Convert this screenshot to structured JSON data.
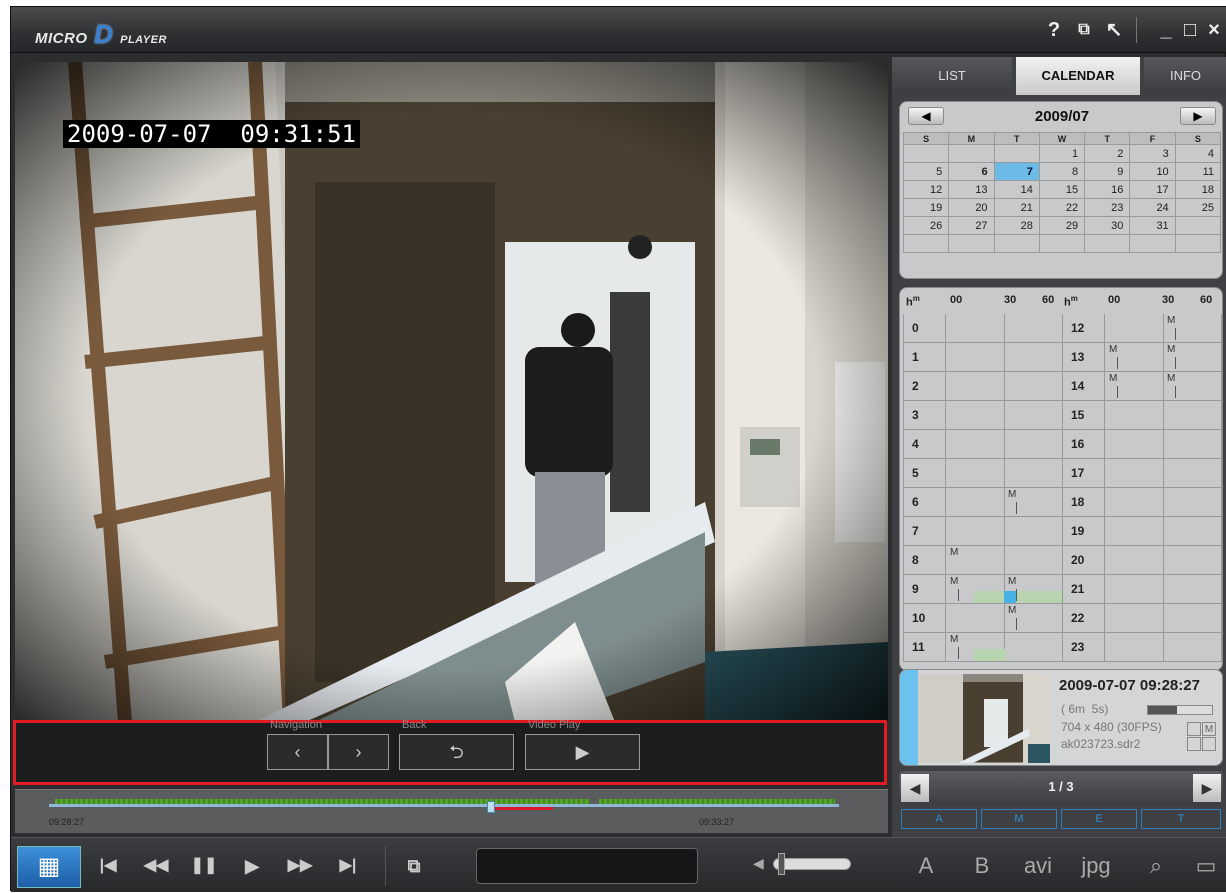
{
  "app": {
    "logo": {
      "micro": "MICRO",
      "d": "D",
      "player": "PLAYER"
    },
    "controls": {
      "help": "?",
      "screen": "⧉",
      "tools": "↖",
      "min": "_",
      "max": "□",
      "close": "×"
    }
  },
  "video": {
    "timestamp": "2009-07-07  09:31:51"
  },
  "nav": {
    "navigation_label": "Navigation",
    "back_label": "Back",
    "videoplay_label": "Video Play",
    "prev_icon": "‹",
    "next_icon": "›",
    "back_icon": "⮌",
    "play_icon": "▶"
  },
  "timeline": {
    "start_time": "09:28:27",
    "end_time": "09:33:27"
  },
  "tabs": {
    "list": "LIST",
    "calendar": "CALENDAR",
    "info": "INFO"
  },
  "calendar": {
    "month": "2009/07",
    "prev": "◀",
    "next": "▶",
    "weekdays": [
      "S",
      "M",
      "T",
      "W",
      "T",
      "F",
      "S"
    ],
    "weeks": [
      [
        "",
        "",
        "",
        "1",
        "2",
        "3",
        "4"
      ],
      [
        "5",
        "6",
        "7",
        "8",
        "9",
        "10",
        "11"
      ],
      [
        "12",
        "13",
        "14",
        "15",
        "16",
        "17",
        "18"
      ],
      [
        "19",
        "20",
        "21",
        "22",
        "23",
        "24",
        "25"
      ],
      [
        "26",
        "27",
        "28",
        "29",
        "30",
        "31",
        ""
      ],
      [
        "",
        "",
        "",
        "",
        "",
        "",
        ""
      ]
    ]
  },
  "hours": {
    "h": "h",
    "m": "m",
    "cols": [
      "00",
      "30",
      "60"
    ],
    "left": [
      "0",
      "1",
      "2",
      "3",
      "4",
      "5",
      "6",
      "7",
      "8",
      "9",
      "10",
      "11"
    ],
    "right": [
      "12",
      "13",
      "14",
      "15",
      "16",
      "17",
      "18",
      "19",
      "20",
      "21",
      "22",
      "23"
    ],
    "marker": "M"
  },
  "preview": {
    "datetime": "2009-07-07 09:28:27",
    "duration": "( 6m  5s)",
    "resolution": "704 x 480 (30FPS)",
    "filename": "ak023723.sdr2",
    "flag": "M"
  },
  "pager": {
    "label": "1 / 3",
    "prev": "◀",
    "next": "▶"
  },
  "filters": [
    "A",
    "M",
    "E",
    "T"
  ],
  "bottom": {
    "grid": "▦",
    "first": "|◀",
    "rewind": "◀◀",
    "pause": "❚❚",
    "play": "▶",
    "forward": "▶▶",
    "last": "▶|",
    "snapshot": "⧉",
    "volume_icon": "◀",
    "a_label": "A",
    "b_label": "B",
    "avi_label": "avi",
    "jpg_label": "jpg",
    "search_icon": "⌕",
    "folder_icon": "▭"
  }
}
